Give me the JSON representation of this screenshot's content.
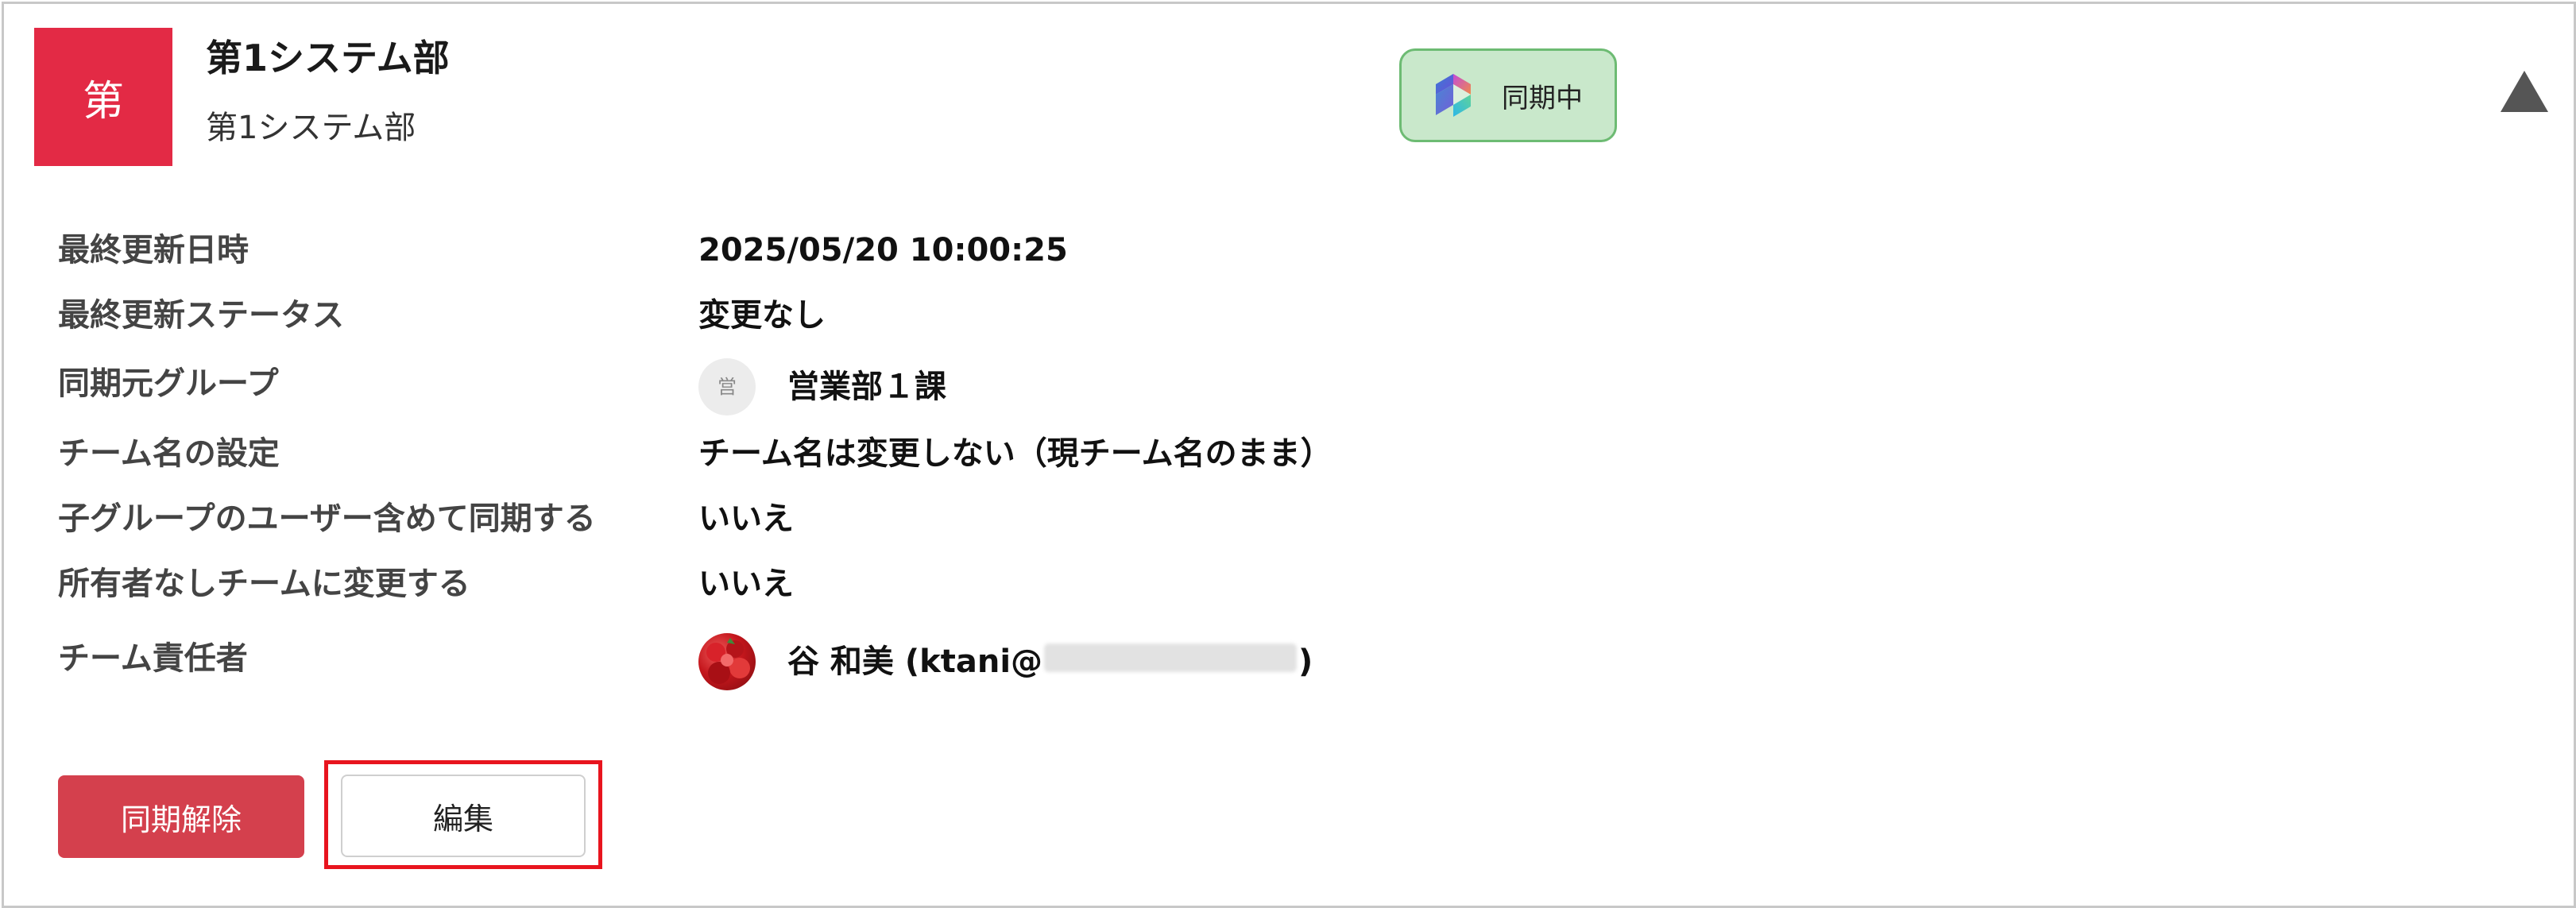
{
  "header": {
    "avatar_text": "第",
    "title": "第1システム部",
    "subtitle": "第1システム部",
    "badge_label": "同期中",
    "badge_icon": "copilot-icon",
    "collapse_icon": "triangle-up-icon"
  },
  "details": [
    {
      "label": "最終更新日時",
      "value": "2025/05/20 10:00:25"
    },
    {
      "label": "最終更新ステータス",
      "value": "変更なし"
    },
    {
      "label": "同期元グループ",
      "value": "営業部１課",
      "avatar_text": "営"
    },
    {
      "label": "チーム名の設定",
      "value": "チーム名は変更しない（現チーム名のまま）"
    },
    {
      "label": "子グループのユーザー含めて同期する",
      "value": "いいえ"
    },
    {
      "label": "所有者なしチームに変更する",
      "value": "いいえ"
    },
    {
      "label": "チーム責任者",
      "value_prefix": "谷 和美 (ktani@",
      "value_suffix": ")"
    }
  ],
  "actions": {
    "unsync_label": "同期解除",
    "edit_label": "編集"
  },
  "colors": {
    "avatar_bg": "#e32a45",
    "badge_bg": "#c9e8cb",
    "badge_border": "#6dbb73",
    "unsync_bg": "#d4404d",
    "highlight": "#e8141e"
  }
}
